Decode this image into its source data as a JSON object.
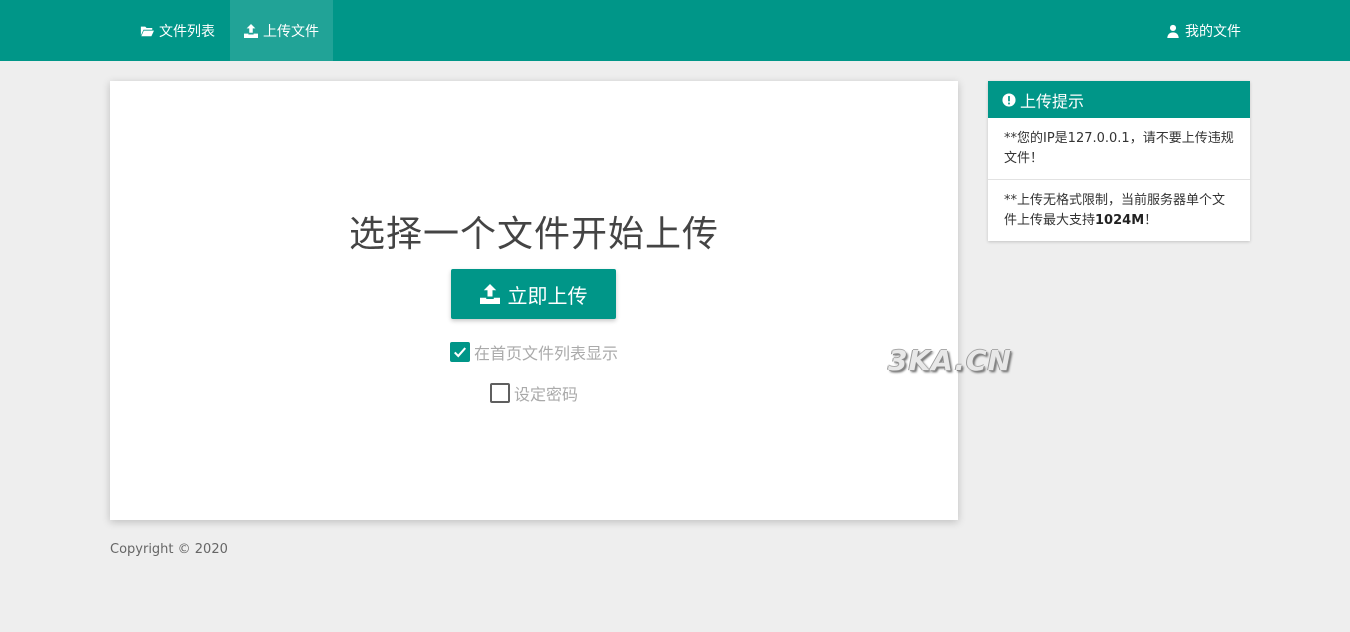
{
  "navbar": {
    "files_label": "文件列表",
    "upload_label": "上传文件",
    "my_files_label": "我的文件",
    "icons": {
      "files": "folder-open-icon",
      "upload": "upload-icon",
      "my_files": "user-icon"
    },
    "active_tab": "上传文件"
  },
  "upload": {
    "title": "选择一个文件开始上传",
    "button_label": "立即上传",
    "show_on_home_label": "在首页文件列表显示",
    "show_on_home_checked": true,
    "set_password_label": "设定密码",
    "set_password_checked": false
  },
  "tips": {
    "title": "上传提示",
    "tip1": "**您的IP是127.0.0.1，请不要上传违规文件！",
    "tip2_prefix": "**上传无格式限制，当前服务器单个文件上传最大支持",
    "tip2_bold": "1024M",
    "tip2_suffix": "！"
  },
  "watermark": "3KA.CN",
  "footer": {
    "copyright": "Copyright © 2020"
  },
  "colors": {
    "primary": "#009688",
    "background": "#eeeeee"
  }
}
